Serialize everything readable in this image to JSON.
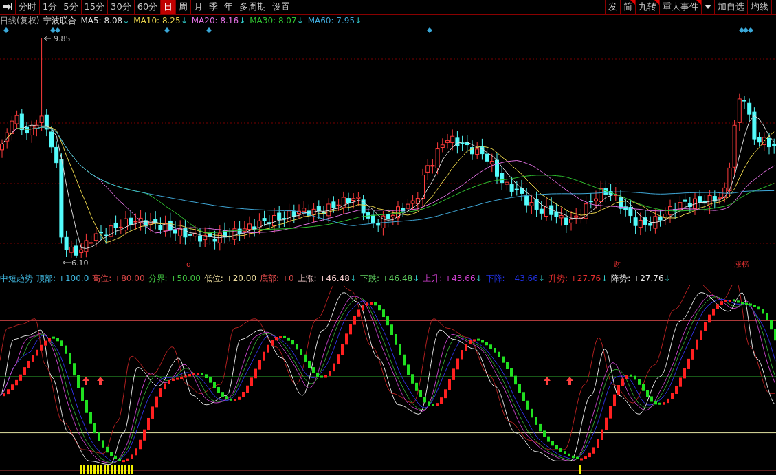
{
  "toolbar": {
    "tabs": [
      {
        "label": "分时",
        "selected": false
      },
      {
        "label": "1分",
        "selected": false
      },
      {
        "label": "5分",
        "selected": false
      },
      {
        "label": "15分",
        "selected": false
      },
      {
        "label": "30分",
        "selected": false
      },
      {
        "label": "60分",
        "selected": false
      },
      {
        "label": "日",
        "selected": true
      },
      {
        "label": "周",
        "selected": false
      },
      {
        "label": "月",
        "selected": false
      },
      {
        "label": "季",
        "selected": false
      },
      {
        "label": "年",
        "selected": false
      },
      {
        "label": "多周期",
        "selected": false
      },
      {
        "label": "设置",
        "selected": false
      }
    ],
    "right_buttons": [
      {
        "label": "发",
        "flagged": false
      },
      {
        "label": "简",
        "flagged": true
      },
      {
        "label": "九转",
        "flagged": true
      },
      {
        "label": "重大事件",
        "flagged": true
      }
    ],
    "extra_buttons": [
      {
        "label": "加自选"
      },
      {
        "label": "均线"
      }
    ]
  },
  "price_legend": {
    "period": "日线(复权)",
    "stock": "宁波联合",
    "items": [
      {
        "label": "MA5:",
        "value": "8.08",
        "arrow": "↓",
        "color": "#dcdcdc"
      },
      {
        "label": "MA10:",
        "value": "8.25",
        "arrow": "↓",
        "color": "#e8d24a"
      },
      {
        "label": "MA20:",
        "value": "8.16",
        "arrow": "↓",
        "color": "#e070e0"
      },
      {
        "label": "MA30:",
        "value": "8.07",
        "arrow": "↓",
        "color": "#30c030"
      },
      {
        "label": "MA60:",
        "value": "7.95",
        "arrow": "↓",
        "color": "#40a8d8"
      }
    ]
  },
  "price_chart": {
    "high_label": "9.85",
    "low_label": "6.10",
    "event_marks": [
      {
        "text": "q"
      },
      {
        "text": "财"
      },
      {
        "text": "涨榜"
      }
    ]
  },
  "indicator_legend": {
    "title": "中短趋势",
    "items": [
      {
        "label": "顶部:",
        "value": "+100.0",
        "color": "#40b8e0"
      },
      {
        "label": "高位:",
        "value": "+80.00",
        "color": "#e04848"
      },
      {
        "label": "分界:",
        "value": "+50.00",
        "color": "#40c040"
      },
      {
        "label": "低位:",
        "value": "+20.00",
        "color": "#f0e0a0"
      },
      {
        "label": "底部:",
        "value": "+0",
        "color": "#f05050"
      },
      {
        "label": "上涨:",
        "value": "+46.48",
        "arrow": "↓",
        "color": "#f0c8c8"
      },
      {
        "label": "下跌:",
        "value": "+46.48",
        "arrow": "↓",
        "color": "#60d060"
      },
      {
        "label": "上升:",
        "value": "+43.66",
        "arrow": "↓",
        "color": "#d040d0"
      },
      {
        "label": "下降:",
        "value": "+43.66",
        "arrow": "↓",
        "color": "#2030e0"
      },
      {
        "label": "升势:",
        "value": "+27.76",
        "arrow": "↓",
        "color": "#e83030"
      },
      {
        "label": "降势:",
        "value": "+27.76",
        "arrow": "↓",
        "color": "#e8e8e8"
      }
    ]
  }
}
